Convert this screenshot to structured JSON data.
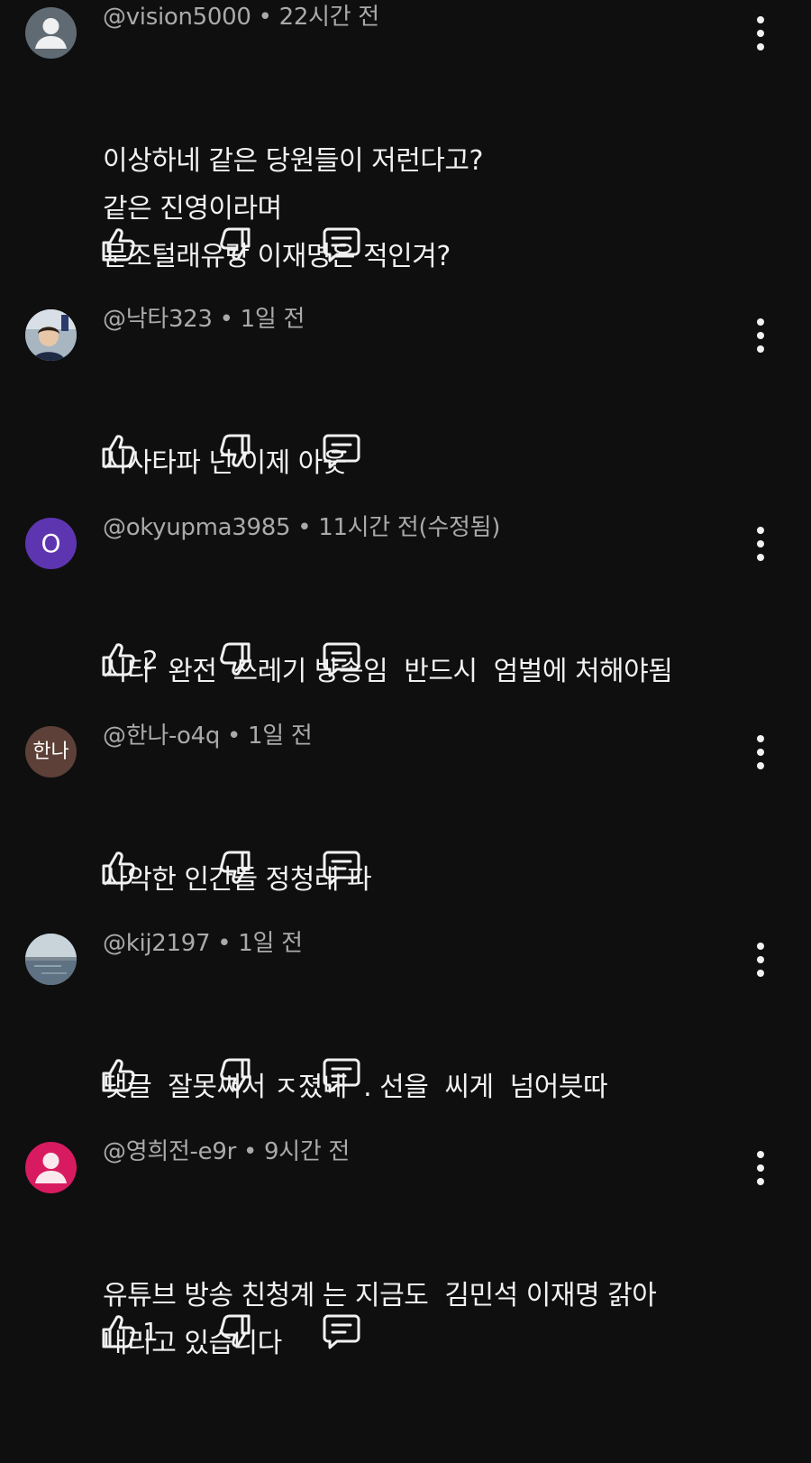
{
  "comments": [
    {
      "handle": "@vision5000",
      "time": "22시간 전",
      "lines": [
        "이상하네 같은 당원들이 저런다고?",
        "같은 진영이라며",
        "문조털래유랑 이재명은 적인겨?"
      ],
      "avatar": {
        "type": "default",
        "bg": "#606a73"
      },
      "likes": ""
    },
    {
      "handle": "@낙타323",
      "time": "1일 전",
      "lines": [
        "시사타파 넌 이제 아웃"
      ],
      "avatar": {
        "type": "photo",
        "bg": "#6c7f8c"
      },
      "likes": ""
    },
    {
      "handle": "@okyupma3985",
      "time": "11시간 전(수정됨)",
      "lines": [
        "시타  완전  쓰레기 방송임  반드시  엄벌에 처해야됨"
      ],
      "avatar": {
        "type": "letter",
        "letter": "O",
        "bg": "#5e35b1"
      },
      "likes": "2"
    },
    {
      "handle": "@한나-o4q",
      "time": "1일 전",
      "lines": [
        "사악한 인간들 정청래 파"
      ],
      "avatar": {
        "type": "letter",
        "letter": "한나",
        "bg": "#5d4037"
      },
      "likes": ""
    },
    {
      "handle": "@kij2197",
      "time": "1일 전",
      "lines": [
        "댓글  잘못써서 ㅈ졌네  . 선을  씨게  넘어븟따"
      ],
      "avatar": {
        "type": "photo-sea",
        "bg": "#8a9aa8"
      },
      "likes": ""
    },
    {
      "handle": "@영희전-e9r",
      "time": "9시간 전",
      "lines": [
        "유튜브 방송 친청계 는 지금도  김민석 이재명 갉아",
        "내리고 있습니다"
      ],
      "avatar": {
        "type": "default",
        "bg": "#d81b60"
      },
      "likes": "1"
    }
  ],
  "icons": {
    "like": "thumbs-up-icon",
    "dislike": "thumbs-down-icon",
    "reply": "reply-icon",
    "menu": "more-vert-icon"
  },
  "colors": {
    "background": "#0f0f0f",
    "text": "#f1f1f1",
    "meta": "#aaaaaa"
  }
}
